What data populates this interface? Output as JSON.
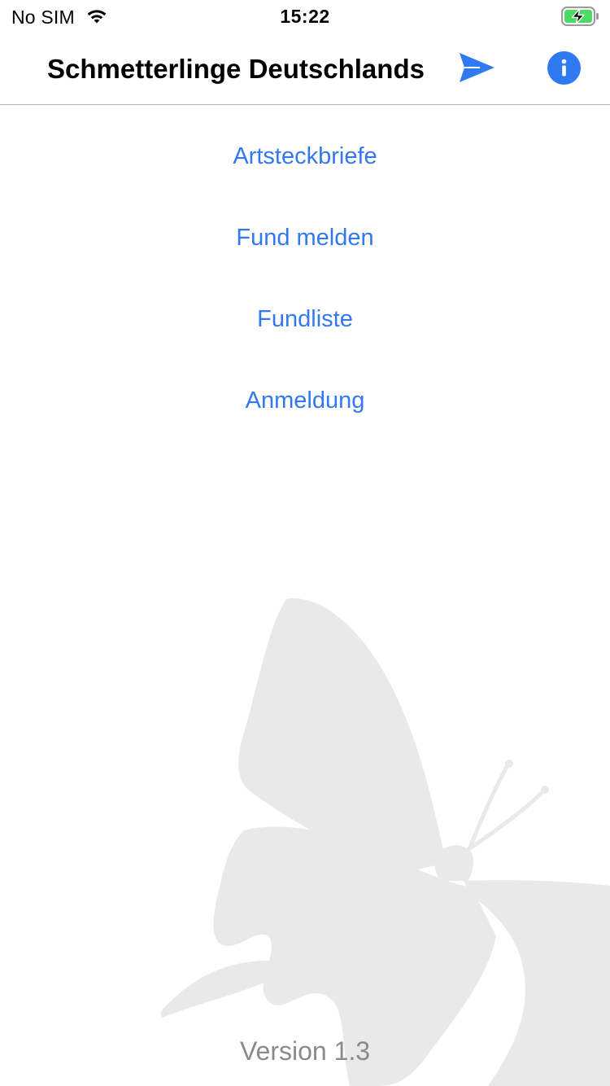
{
  "status_bar": {
    "carrier": "No SIM",
    "time": "15:22",
    "wifi_icon": "wifi-icon",
    "battery_icon": "battery-charging-icon"
  },
  "nav_bar": {
    "title": "Schmetterlinge Deutschlands",
    "send_icon": "send-icon",
    "info_icon": "info-icon",
    "accent_color": "#2f7af0"
  },
  "menu": {
    "items": [
      {
        "label": "Artsteckbriefe"
      },
      {
        "label": "Fund melden"
      },
      {
        "label": "Fundliste"
      },
      {
        "label": "Anmeldung"
      }
    ],
    "link_color": "#3478f0"
  },
  "background": {
    "image": "butterfly-silhouette"
  },
  "footer": {
    "version": "Version 1.3"
  }
}
